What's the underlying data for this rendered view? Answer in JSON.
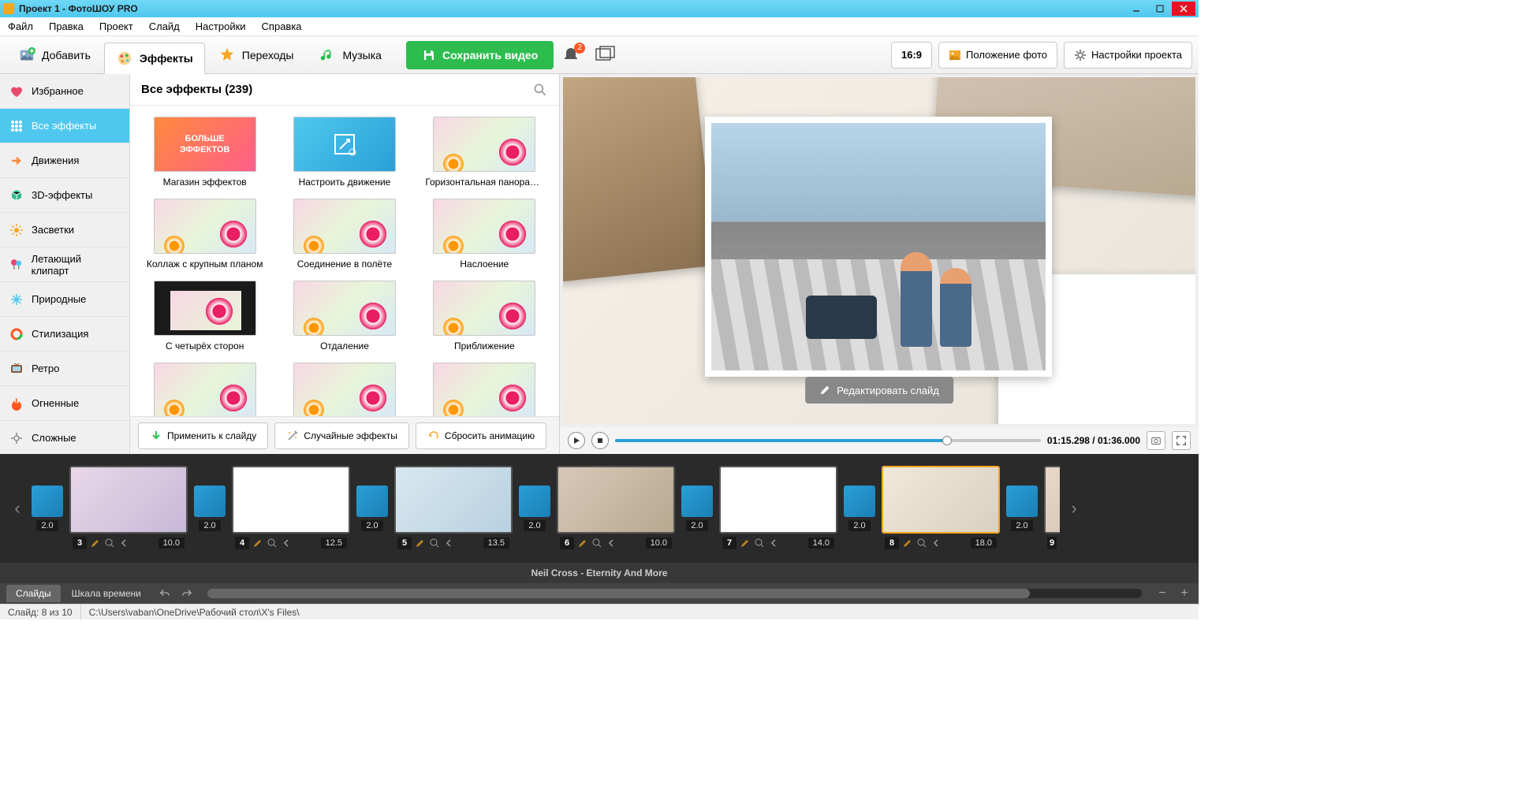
{
  "window": {
    "title": "Проект 1 - ФотоШОУ PRO"
  },
  "menu": [
    "Файл",
    "Правка",
    "Проект",
    "Слайд",
    "Настройки",
    "Справка"
  ],
  "toolbar": {
    "add": "Добавить",
    "effects": "Эффекты",
    "transitions": "Переходы",
    "music": "Музыка",
    "save": "Сохранить видео",
    "notif_count": "2",
    "ratio": "16:9",
    "position": "Положение фото",
    "project_settings": "Настройки проекта"
  },
  "sidebar": {
    "items": [
      {
        "label": "Избранное",
        "icon": "heart",
        "color": "#e84a6f"
      },
      {
        "label": "Все эффекты",
        "icon": "grid",
        "color": "#fff"
      },
      {
        "label": "Движения",
        "icon": "arrow",
        "color": "#ff8a3c"
      },
      {
        "label": "3D-эффекты",
        "icon": "cube",
        "color": "#2dbd8f"
      },
      {
        "label": "Засветки",
        "icon": "sun",
        "color": "#f5a623"
      },
      {
        "label": "Летающий клипарт",
        "icon": "balloon",
        "color": "#e84a6f"
      },
      {
        "label": "Природные",
        "icon": "snow",
        "color": "#4fc8ef"
      },
      {
        "label": "Стилизация",
        "icon": "circle",
        "color": "#ff5722"
      },
      {
        "label": "Ретро",
        "icon": "tv",
        "color": "#8a5a3a"
      },
      {
        "label": "Огненные",
        "icon": "fire",
        "color": "#ff5722"
      },
      {
        "label": "Сложные",
        "icon": "gear",
        "color": "#888"
      }
    ],
    "active_index": 1
  },
  "effects": {
    "header": "Все эффекты (239)",
    "items": [
      {
        "label": "Магазин эффектов",
        "type": "more",
        "more_text": "БОЛЬШЕ ЭФФЕКТОВ"
      },
      {
        "label": "Настроить движение",
        "type": "config"
      },
      {
        "label": "Горизонтальная панорам...",
        "type": "flower"
      },
      {
        "label": "Коллаж с крупным планом",
        "type": "flower"
      },
      {
        "label": "Соединение в полёте",
        "type": "flower"
      },
      {
        "label": "Наслоение",
        "type": "flower"
      },
      {
        "label": "С четырёх сторон",
        "type": "dark"
      },
      {
        "label": "Отдаление",
        "type": "flower"
      },
      {
        "label": "Приближение",
        "type": "flower"
      },
      {
        "label": "",
        "type": "flower"
      },
      {
        "label": "",
        "type": "flower"
      },
      {
        "label": "",
        "type": "flower"
      }
    ],
    "actions": {
      "apply": "Применить к слайду",
      "random": "Случайные эффекты",
      "reset": "Сбросить анимацию"
    }
  },
  "preview": {
    "edit_btn": "Редактировать слайд",
    "time": "01:15.298 / 01:36.000"
  },
  "timeline": {
    "slides": [
      {
        "num": "3",
        "dur": "10.0",
        "trans": "2.0"
      },
      {
        "num": "4",
        "dur": "12.5",
        "trans": "2.0"
      },
      {
        "num": "5",
        "dur": "13.5",
        "trans": "2.0"
      },
      {
        "num": "6",
        "dur": "10.0",
        "trans": "2.0"
      },
      {
        "num": "7",
        "dur": "14.0",
        "trans": "2.0"
      },
      {
        "num": "8",
        "dur": "18.0",
        "trans": "2.0",
        "selected": true
      }
    ],
    "trailing_num": "9",
    "audio": "Neil Cross - Eternity And More"
  },
  "bottom": {
    "tabs": [
      "Слайды",
      "Шкала времени"
    ],
    "active_tab": 0
  },
  "status": {
    "slide": "Слайд: 8 из 10",
    "path": "C:\\Users\\vaban\\OneDrive\\Рабочий стол\\X's Files\\"
  }
}
